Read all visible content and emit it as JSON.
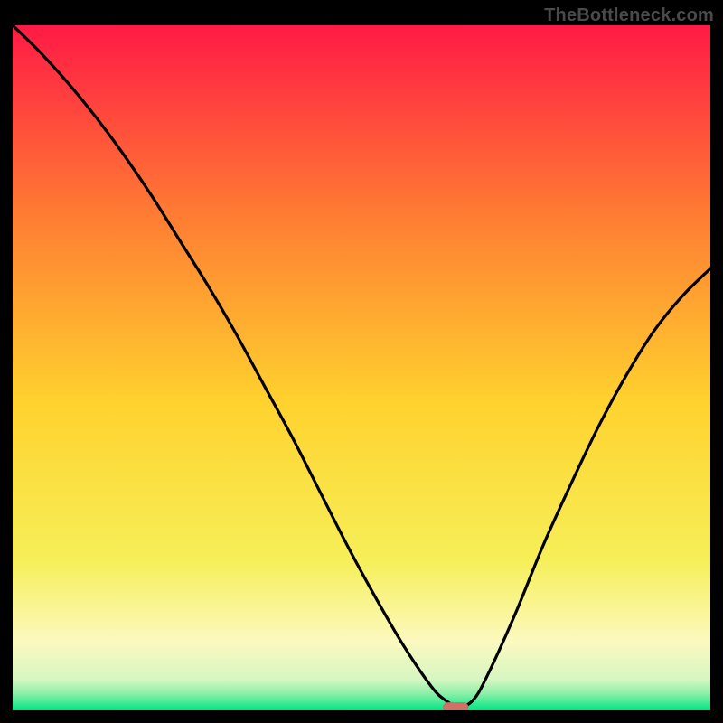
{
  "watermark": "TheBottleneck.com",
  "colors": {
    "top": "#ff1a45",
    "upper_mid": "#ff7d33",
    "mid": "#ffd22e",
    "lower_mid": "#f6ef58",
    "pale": "#fbf9bf",
    "green_light": "#8ef0a9",
    "green": "#00e583",
    "marker": "#cf7166",
    "curve": "#000000",
    "frame": "#000000"
  },
  "chart_data": {
    "type": "line",
    "title": "",
    "xlabel": "",
    "ylabel": "",
    "xlim": [
      0,
      100
    ],
    "ylim": [
      0,
      100
    ],
    "x": [
      0,
      4,
      8,
      12,
      16,
      20,
      24,
      28,
      32,
      36,
      40,
      44,
      48,
      52,
      56,
      60,
      62,
      64,
      66,
      68,
      72,
      76,
      80,
      84,
      88,
      92,
      96,
      100
    ],
    "values": [
      100,
      96,
      91.5,
      86.5,
      81,
      75,
      68.5,
      62,
      55,
      47.5,
      40,
      32,
      24,
      16.5,
      9.5,
      3.5,
      1.5,
      0.5,
      1.5,
      5,
      14,
      24,
      33,
      41.5,
      49,
      55.5,
      60.5,
      64.5
    ],
    "marker": {
      "x": 63.5,
      "y": 0.5,
      "width": 3.5,
      "height": 1.2
    },
    "annotations": []
  }
}
